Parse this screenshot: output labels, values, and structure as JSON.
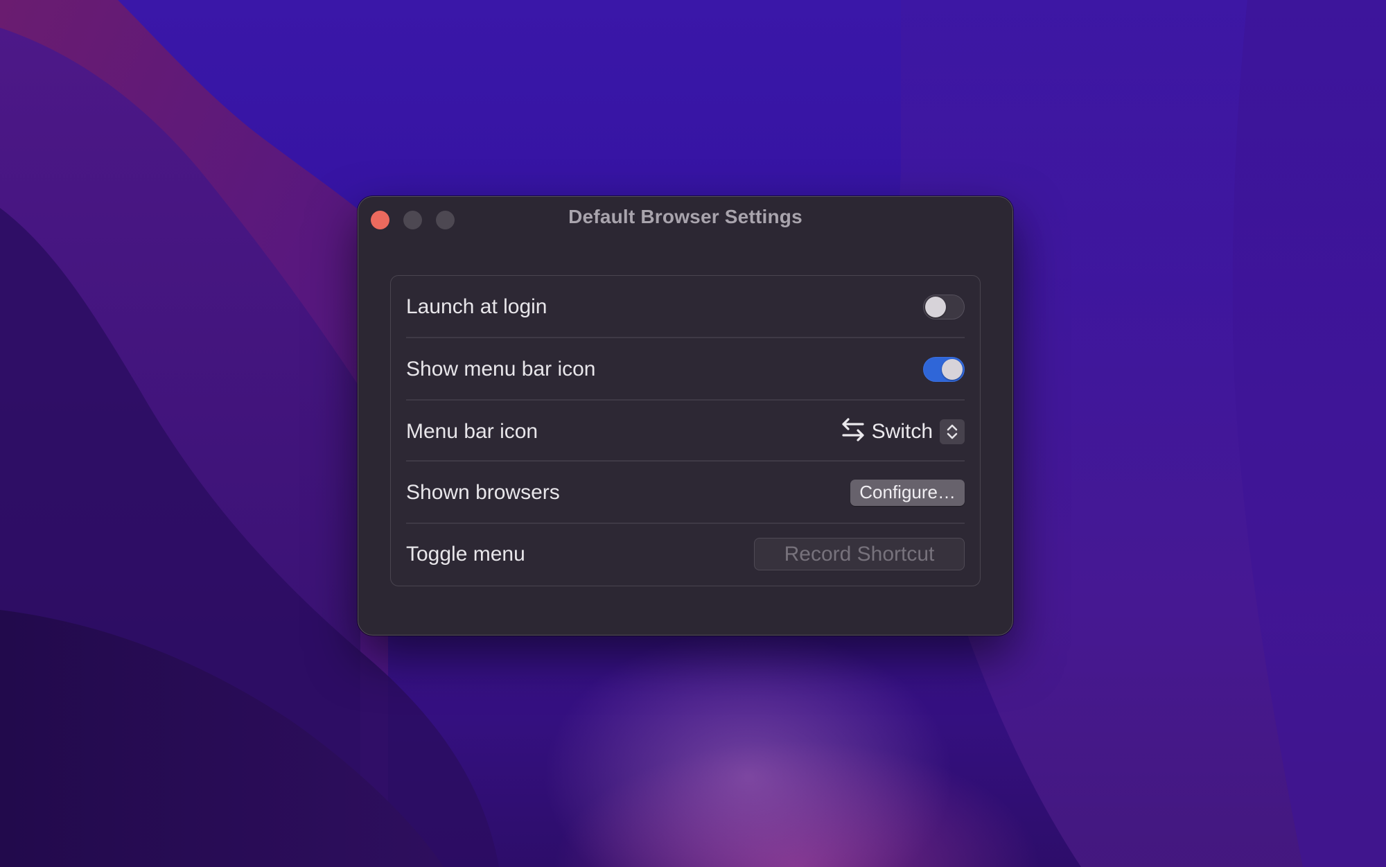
{
  "window": {
    "title": "Default Browser Settings",
    "controls": {
      "close": {
        "color": "#ec6a5e"
      },
      "minimize": {
        "color": "#4d4852"
      },
      "zoom": {
        "color": "#4d4852"
      }
    }
  },
  "settings": {
    "rows": [
      {
        "label": "Launch at login",
        "control": "toggle",
        "value": false
      },
      {
        "label": "Show menu bar icon",
        "control": "toggle",
        "value": true
      },
      {
        "label": "Menu bar icon",
        "control": "popup",
        "value": "Switch",
        "icon": "arrows-left-right-icon"
      },
      {
        "label": "Shown browsers",
        "control": "button",
        "button_label": "Configure…"
      },
      {
        "label": "Toggle menu",
        "control": "shortcut-recorder",
        "placeholder": "Record Shortcut"
      }
    ]
  },
  "colors": {
    "accent": "#2f66d8",
    "window_bg": "#2c2733"
  }
}
